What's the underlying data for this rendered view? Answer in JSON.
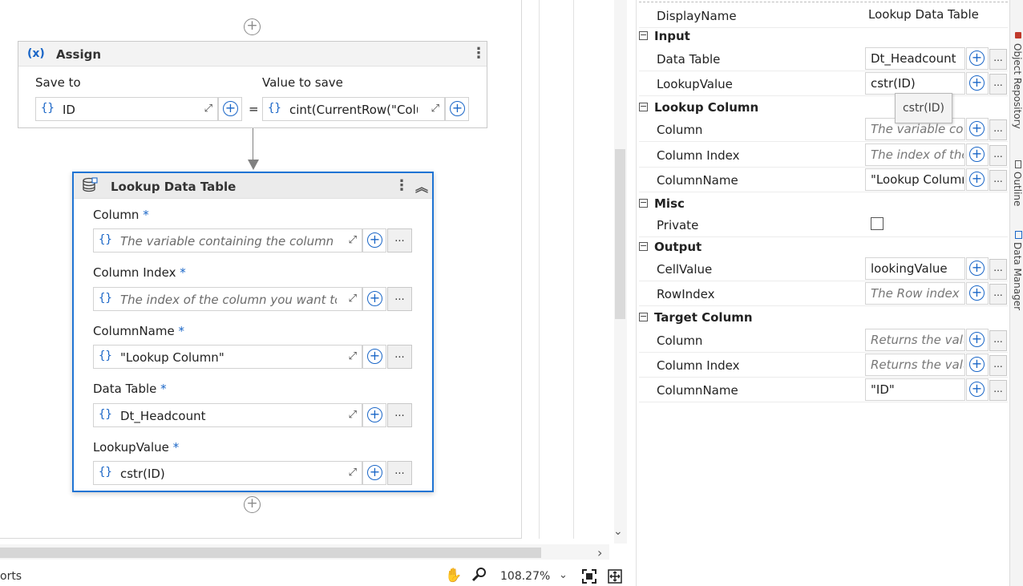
{
  "designer": {
    "assign": {
      "title": "Assign",
      "icon": "variable-x-icon",
      "save_to_label": "Save to",
      "value_to_save_label": "Value to save",
      "save_to_value": "ID",
      "value_to_save_value": "cint(CurrentRow(\"Colu",
      "equals": "="
    },
    "lookup": {
      "title": "Lookup Data Table",
      "icon": "database-icon",
      "fields": [
        {
          "label": "Column",
          "req": "*",
          "value": "The variable containing the column yo",
          "placeholder": true
        },
        {
          "label": "Column Index",
          "req": "*",
          "value": "The index of the column you want to s",
          "placeholder": true
        },
        {
          "label": "ColumnName",
          "req": "*",
          "value": "\"Lookup Column\"",
          "placeholder": false
        },
        {
          "label": "Data Table",
          "req": "*",
          "value": "Dt_Headcount",
          "placeholder": false
        },
        {
          "label": "LookupValue",
          "req": "*",
          "value": "cstr(ID)",
          "placeholder": false
        }
      ]
    },
    "brace": "{}",
    "plus": "+",
    "dots": "...",
    "expand": "⤢",
    "status_text": "orts",
    "zoom": "108.27%"
  },
  "properties": {
    "display_name_label": "DisplayName",
    "display_name_value": "Lookup Data Table",
    "categories": {
      "input": "Input",
      "lookup_column": "Lookup Column",
      "misc": "Misc",
      "output": "Output",
      "target_column": "Target Column"
    },
    "rows": {
      "data_table": {
        "name": "Data Table",
        "value": "Dt_Headcount"
      },
      "lookup_value": {
        "name": "LookupValue",
        "value": "cstr(ID)"
      },
      "lc_column": {
        "name": "Column",
        "value": "The variable conta"
      },
      "lc_column_index": {
        "name": "Column Index",
        "value": "The index of the c"
      },
      "lc_column_name": {
        "name": "ColumnName",
        "value": "\"Lookup Column\""
      },
      "private": {
        "name": "Private"
      },
      "cell_value": {
        "name": "CellValue",
        "value": "lookingValue"
      },
      "row_index": {
        "name": "RowIndex",
        "value": "The Row index of"
      },
      "tc_column": {
        "name": "Column",
        "value": "Returns the value"
      },
      "tc_column_index": {
        "name": "Column Index",
        "value": "Returns the value"
      },
      "tc_column_name": {
        "name": "ColumnName",
        "value": "\"ID\""
      }
    },
    "tooltip": "cstr(ID)",
    "collapse_glyph": "−"
  },
  "side_tabs": [
    "Object Repository",
    "Outline",
    "Data Manager"
  ]
}
